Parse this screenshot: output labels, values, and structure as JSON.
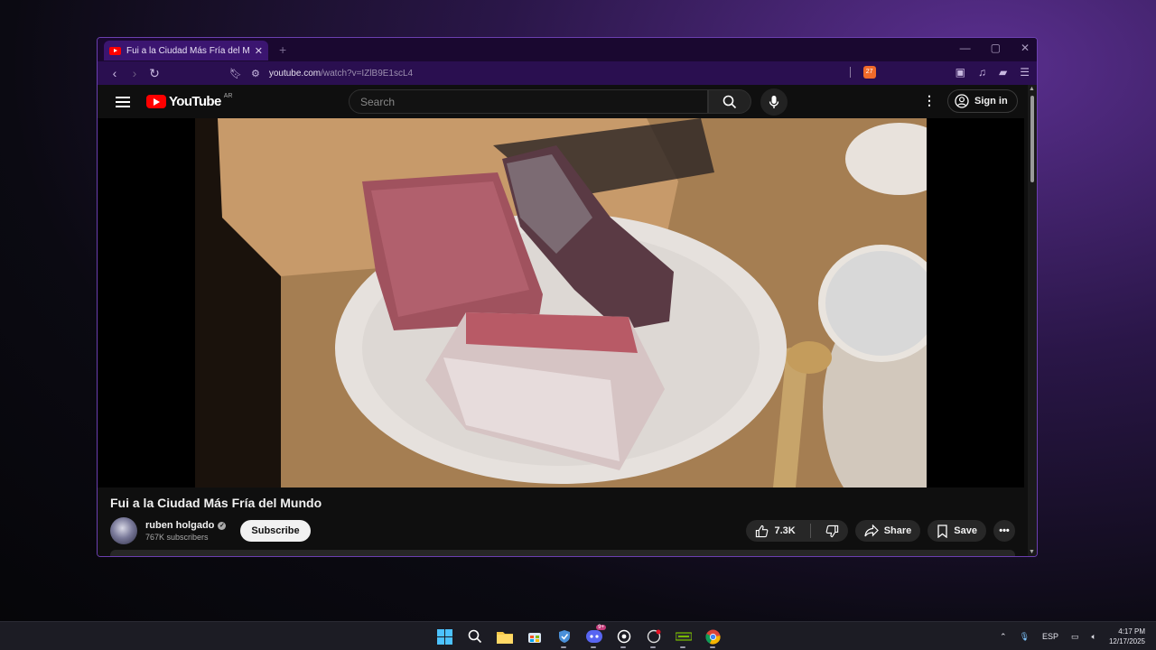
{
  "browser": {
    "tab_title": "Fui a la Ciudad Más Fría del Mundo - YouTube",
    "new_tab_icon": "plus-icon",
    "url_host": "youtube.com",
    "url_path": "/watch?v=IZlB9E1scL4",
    "brave_badge": "27"
  },
  "youtube": {
    "logo_text": "YouTube",
    "country_code": "AR",
    "search_placeholder": "Search",
    "sign_in_label": "Sign in",
    "video": {
      "title": "Fui a la Ciudad Más Fría del Mundo",
      "channel_name": "ruben holgado",
      "subscribers": "767K subscribers",
      "subscribe_label": "Subscribe",
      "likes": "7.3K",
      "share_label": "Share",
      "save_label": "Save"
    }
  },
  "taskbar": {
    "discord_badge": "9+",
    "language": "ESP",
    "time": "4:17 PM",
    "date": "12/17/2025"
  },
  "colors": {
    "accent": "#6b3fb0",
    "youtube_red": "#ff0000",
    "yt_background": "#0f0f0f"
  }
}
